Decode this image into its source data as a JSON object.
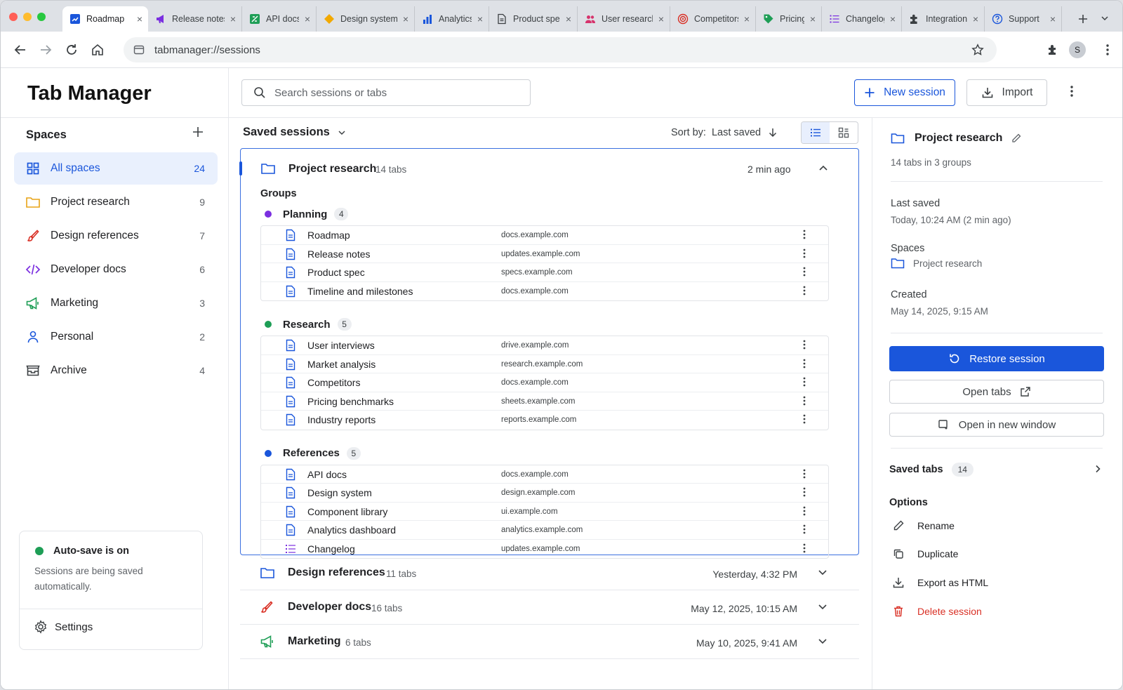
{
  "browser": {
    "tabs": [
      {
        "label": "Roadmap",
        "icon": "roadmap-icon",
        "active": true
      },
      {
        "label": "Release notes",
        "icon": "megaphone-icon"
      },
      {
        "label": "API docs",
        "icon": "api-icon"
      },
      {
        "label": "Design system",
        "icon": "diamond-icon"
      },
      {
        "label": "Analytics",
        "icon": "bar-chart-icon"
      },
      {
        "label": "Product spec",
        "icon": "document-icon"
      },
      {
        "label": "User research",
        "icon": "users-icon"
      },
      {
        "label": "Competitors",
        "icon": "target-icon"
      },
      {
        "label": "Pricing",
        "icon": "price-tag-icon"
      },
      {
        "label": "Changelog",
        "icon": "list-icon"
      },
      {
        "label": "Integrations",
        "icon": "puzzle-icon"
      },
      {
        "label": "Support",
        "icon": "help-icon"
      }
    ],
    "url": "tabmanager://sessions",
    "profile_initial": "S"
  },
  "app": {
    "title": "Tab Manager",
    "search_placeholder": "Search sessions or tabs",
    "new_session_label": "New session",
    "import_label": "Import"
  },
  "sidebar": {
    "spaces_title": "Spaces",
    "spaces": [
      {
        "label": "All spaces",
        "count": "24",
        "icon": "grid-icon",
        "active": true
      },
      {
        "label": "Project research",
        "count": "9",
        "icon": "folder-icon"
      },
      {
        "label": "Design references",
        "count": "7",
        "icon": "paintbrush-icon"
      },
      {
        "label": "Developer docs",
        "count": "6",
        "icon": "code-icon"
      },
      {
        "label": "Marketing",
        "count": "3",
        "icon": "megaphone-icon"
      },
      {
        "label": "Personal",
        "count": "2",
        "icon": "person-icon"
      },
      {
        "label": "Archive",
        "count": "4",
        "icon": "archive-icon"
      }
    ],
    "autosave": {
      "title": "Auto-save is on",
      "text": "Sessions are being saved automatically.",
      "settings_label": "Settings"
    }
  },
  "main": {
    "list_title": "Saved sessions",
    "sort_label": "Sort by:",
    "sort_value": "Last saved",
    "expanded": {
      "name": "Project research",
      "tab_count": "14 tabs",
      "when": "2 min ago",
      "groups_label": "Groups",
      "groups": [
        {
          "name": "Planning",
          "count": "4",
          "color": "#7b2fe0",
          "tabs": [
            {
              "name": "Roadmap",
              "url": "docs.example.com",
              "icon": "document-icon"
            },
            {
              "name": "Release notes",
              "url": "updates.example.com",
              "icon": "document-icon"
            },
            {
              "name": "Product spec",
              "url": "specs.example.com",
              "icon": "document-icon"
            },
            {
              "name": "Timeline and milestones",
              "url": "docs.example.com",
              "icon": "document-icon"
            }
          ]
        },
        {
          "name": "Research",
          "count": "5",
          "color": "#1e9e56",
          "tabs": [
            {
              "name": "User interviews",
              "url": "drive.example.com",
              "icon": "document-icon"
            },
            {
              "name": "Market analysis",
              "url": "research.example.com",
              "icon": "document-icon"
            },
            {
              "name": "Competitors",
              "url": "docs.example.com",
              "icon": "document-icon"
            },
            {
              "name": "Pricing benchmarks",
              "url": "sheets.example.com",
              "icon": "document-icon"
            },
            {
              "name": "Industry reports",
              "url": "reports.example.com",
              "icon": "document-icon"
            }
          ]
        },
        {
          "name": "References",
          "count": "5",
          "color": "#1a56db",
          "tabs": [
            {
              "name": "API docs",
              "url": "docs.example.com",
              "icon": "document-icon"
            },
            {
              "name": "Design system",
              "url": "design.example.com",
              "icon": "document-icon"
            },
            {
              "name": "Component library",
              "url": "ui.example.com",
              "icon": "document-icon"
            },
            {
              "name": "Analytics dashboard",
              "url": "analytics.example.com",
              "icon": "document-icon"
            },
            {
              "name": "Changelog",
              "url": "updates.example.com",
              "icon": "list-icon"
            }
          ]
        }
      ]
    },
    "collapsed": [
      {
        "name": "Design references",
        "tab_count": "11 tabs",
        "when": "Yesterday, 4:32 PM",
        "icon": "folder-icon"
      },
      {
        "name": "Developer docs",
        "tab_count": "16 tabs",
        "when": "May 12, 2025, 10:15 AM",
        "icon": "paintbrush-icon"
      },
      {
        "name": "Marketing",
        "tab_count": "6 tabs",
        "when": "May 10, 2025, 9:41 AM",
        "icon": "megaphone-icon"
      }
    ]
  },
  "detail": {
    "title": "Project research",
    "subtitle": "14 tabs in 3 groups",
    "last_saved_label": "Last saved",
    "last_saved_value": "Today, 10:24 AM (2 min ago)",
    "spaces_label": "Spaces",
    "spaces_value": "Project research",
    "created_label": "Created",
    "created_value": "May 14, 2025, 9:15 AM",
    "restore_label": "Restore session",
    "open_tabs_label": "Open tabs",
    "open_window_label": "Open in new window",
    "saved_tabs_label": "Saved tabs",
    "saved_tabs_count": "14",
    "options_label": "Options",
    "options": [
      {
        "label": "Rename",
        "icon": "pencil-icon"
      },
      {
        "label": "Duplicate",
        "icon": "copy-icon"
      },
      {
        "label": "Export as HTML",
        "icon": "download-icon"
      },
      {
        "label": "Delete session",
        "icon": "trash-icon",
        "danger": true
      }
    ]
  },
  "colors": {
    "accent": "#1a56db",
    "danger": "#d93025",
    "success": "#1e9e56",
    "folder": "#e8a317"
  }
}
